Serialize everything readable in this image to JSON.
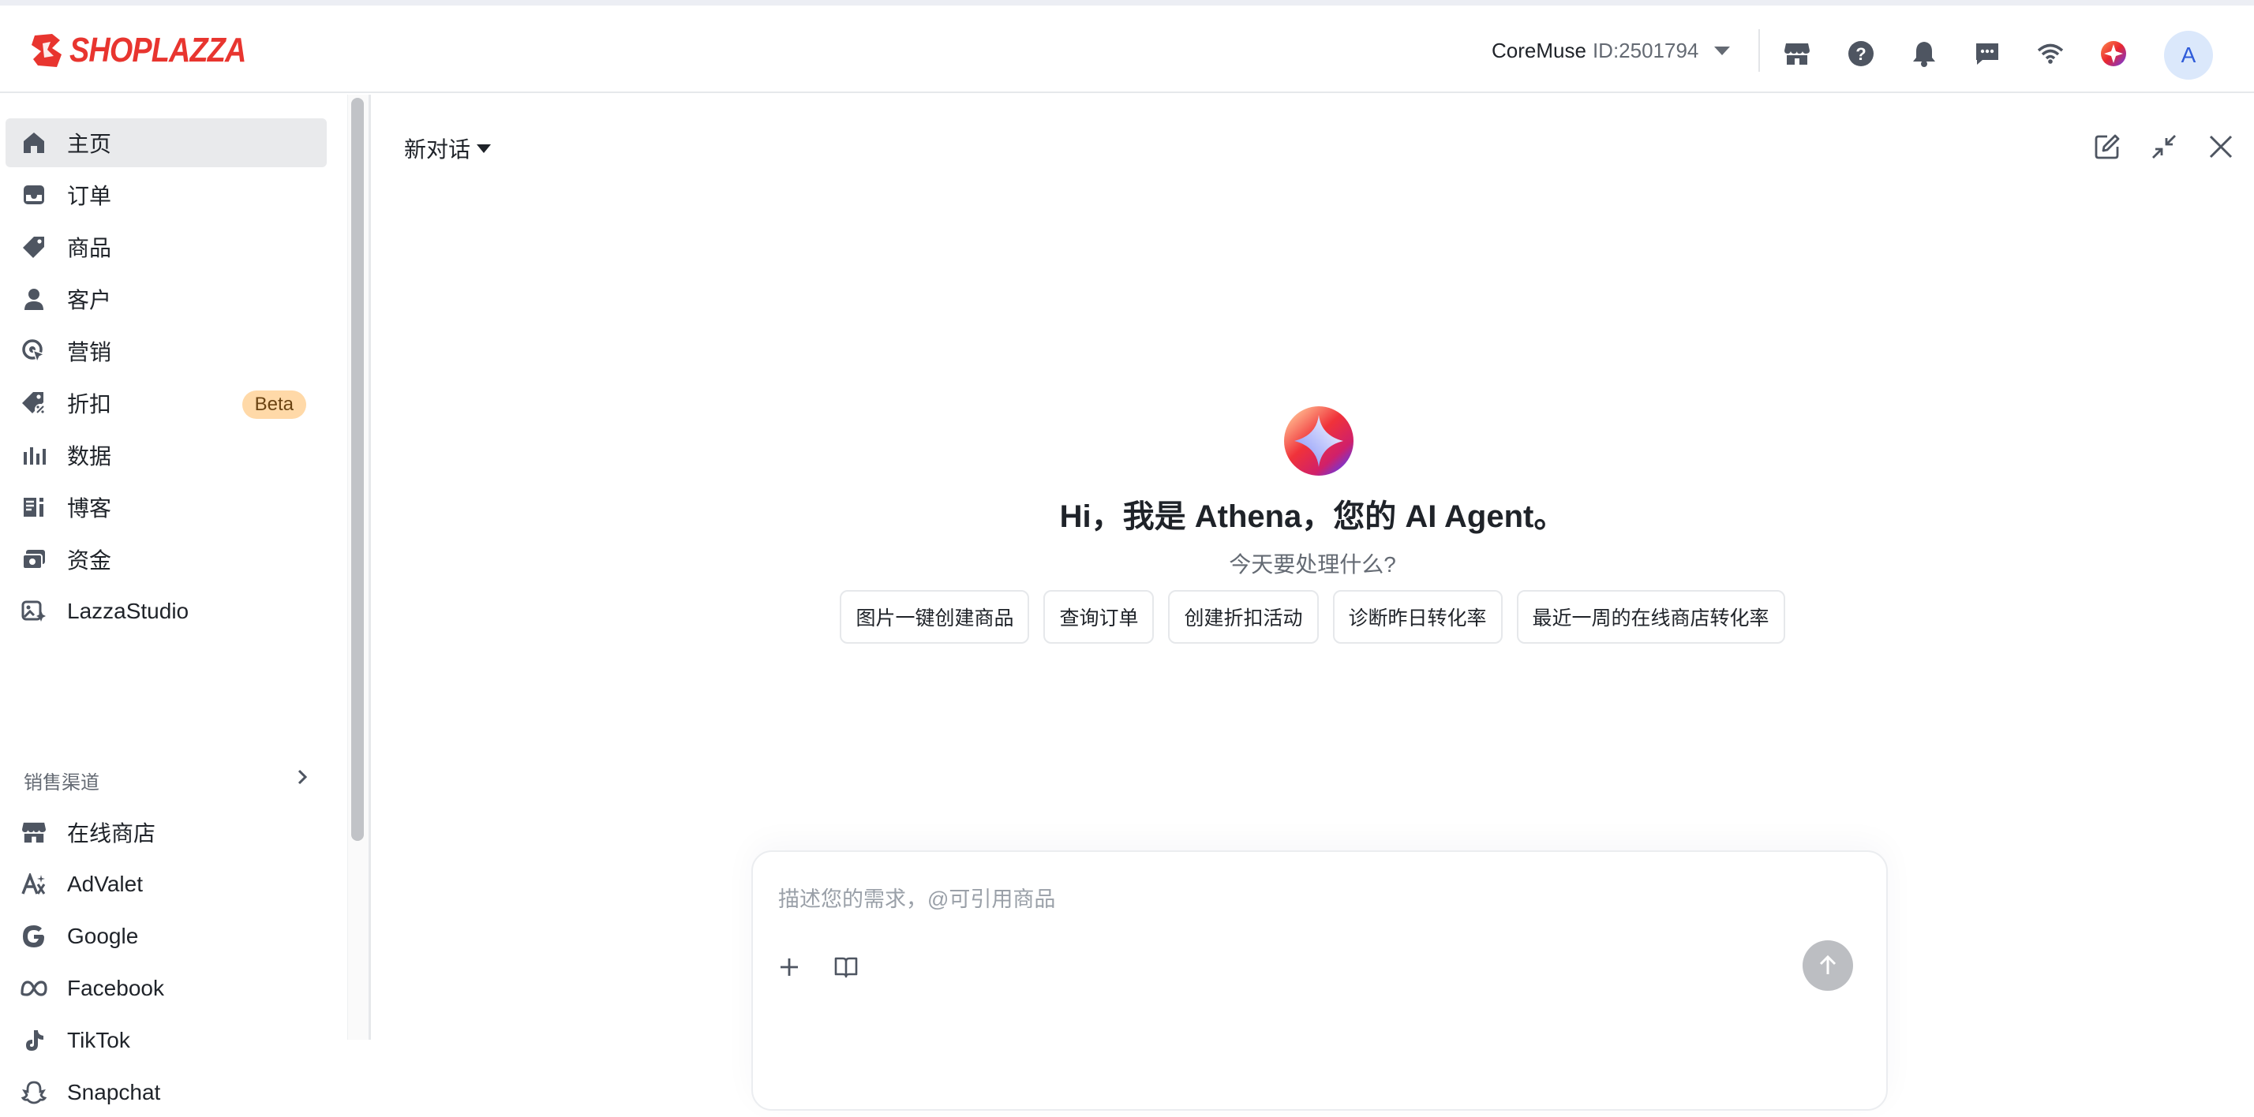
{
  "header": {
    "logo_text": "SHOPLAZZA",
    "store_name": "CoreMuse",
    "store_id": "ID:2501794",
    "avatar_initial": "A"
  },
  "sidebar": {
    "items": [
      {
        "label": "主页",
        "icon": "home-icon",
        "active": true
      },
      {
        "label": "订单",
        "icon": "inbox-icon"
      },
      {
        "label": "商品",
        "icon": "tag-icon"
      },
      {
        "label": "客户",
        "icon": "person-icon"
      },
      {
        "label": "营销",
        "icon": "target-icon"
      },
      {
        "label": "折扣",
        "icon": "discount-tag-icon",
        "badge": "Beta"
      },
      {
        "label": "数据",
        "icon": "bar-chart-icon"
      },
      {
        "label": "博客",
        "icon": "blog-icon"
      },
      {
        "label": "资金",
        "icon": "money-icon"
      },
      {
        "label": "LazzaStudio",
        "icon": "studio-icon"
      }
    ],
    "section_title": "销售渠道",
    "channels": [
      {
        "label": "在线商店",
        "icon": "store-icon"
      },
      {
        "label": "AdValet",
        "icon": "advalet-icon"
      },
      {
        "label": "Google",
        "icon": "google-icon"
      },
      {
        "label": "Facebook",
        "icon": "meta-icon"
      },
      {
        "label": "TikTok",
        "icon": "tiktok-icon"
      },
      {
        "label": "Snapchat",
        "icon": "snapchat-icon"
      }
    ]
  },
  "chat": {
    "conversation_title": "新对话",
    "greeting": "Hi，我是 Athena，您的 AI Agent。",
    "subtitle": "今天要处理什么?",
    "suggestions": [
      "图片一键创建商品",
      "查询订单",
      "创建折扣活动",
      "诊断昨日转化率",
      "最近一周的在线商店转化率"
    ],
    "input_placeholder": "描述您的需求，@可引用商品"
  },
  "colors": {
    "brand": "#e8352f",
    "active_bg": "#e9eaec",
    "beta_bg": "#ffd9a8"
  }
}
